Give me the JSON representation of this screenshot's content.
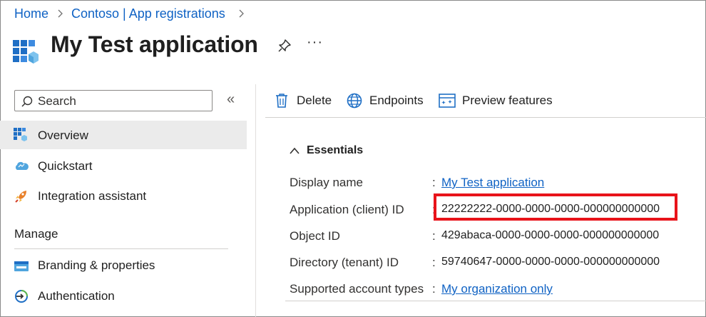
{
  "breadcrumb": {
    "items": [
      "Home",
      "Contoso | App registrations"
    ]
  },
  "header": {
    "title": "My Test application",
    "more_label": "···"
  },
  "sidebar": {
    "search_placeholder": "Search",
    "collapse_label": "«",
    "items": [
      {
        "label": "Overview",
        "selected": true,
        "icon": "app-grid-icon"
      },
      {
        "label": "Quickstart",
        "icon": "cloud-icon"
      },
      {
        "label": "Integration assistant",
        "icon": "rocket-icon"
      }
    ],
    "manage": {
      "title": "Manage",
      "items": [
        {
          "label": "Branding & properties",
          "icon": "branding-icon"
        },
        {
          "label": "Authentication",
          "icon": "authentication-icon"
        }
      ]
    }
  },
  "toolbar": {
    "delete_label": "Delete",
    "endpoints_label": "Endpoints",
    "preview_label": "Preview features"
  },
  "essentials": {
    "title": "Essentials",
    "rows": [
      {
        "label": "Display name",
        "value": "My Test application",
        "link": true
      },
      {
        "label": "Application (client) ID",
        "value": "22222222-0000-0000-0000-000000000000",
        "highlighted": true
      },
      {
        "label": "Object ID",
        "value": "429abaca-0000-0000-0000-000000000000"
      },
      {
        "label": "Directory (tenant) ID",
        "value": "59740647-0000-0000-0000-000000000000"
      },
      {
        "label": "Supported account types",
        "value": "My organization only",
        "link": true
      }
    ]
  },
  "colors": {
    "accent": "#0f62c4",
    "highlight": "#e8131a",
    "selected_bg": "#ebebeb"
  }
}
